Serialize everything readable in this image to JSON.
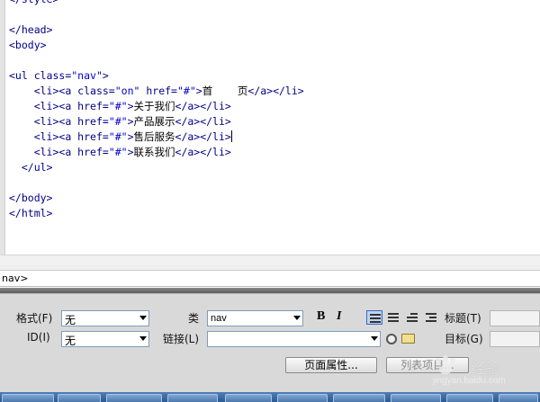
{
  "editor": {
    "lines": [
      [
        {
          "c": "t",
          "s": "</style>"
        }
      ],
      [],
      [
        {
          "c": "t",
          "s": "</head>"
        }
      ],
      [
        {
          "c": "t",
          "s": "<body>"
        }
      ],
      [],
      [
        {
          "c": "t",
          "s": "<ul "
        },
        {
          "c": "a",
          "s": "class="
        },
        {
          "c": "v",
          "s": "\"nav\""
        },
        {
          "c": "t",
          "s": ">"
        }
      ],
      [
        {
          "c": "x",
          "s": "    "
        },
        {
          "c": "t",
          "s": "<li><a "
        },
        {
          "c": "a",
          "s": "class="
        },
        {
          "c": "v",
          "s": "\"on\""
        },
        {
          "c": "a",
          "s": " href="
        },
        {
          "c": "v",
          "s": "\"#\""
        },
        {
          "c": "t",
          "s": ">"
        },
        {
          "c": "x",
          "s": "首    页"
        },
        {
          "c": "t",
          "s": "</a></li>"
        }
      ],
      [
        {
          "c": "x",
          "s": "    "
        },
        {
          "c": "t",
          "s": "<li><a "
        },
        {
          "c": "a",
          "s": "href="
        },
        {
          "c": "v",
          "s": "\"#\""
        },
        {
          "c": "t",
          "s": ">"
        },
        {
          "c": "x",
          "s": "关于我们"
        },
        {
          "c": "t",
          "s": "</a></li>"
        }
      ],
      [
        {
          "c": "x",
          "s": "    "
        },
        {
          "c": "t",
          "s": "<li><a "
        },
        {
          "c": "a",
          "s": "href="
        },
        {
          "c": "v",
          "s": "\"#\""
        },
        {
          "c": "t",
          "s": ">"
        },
        {
          "c": "x",
          "s": "产品展示"
        },
        {
          "c": "t",
          "s": "</a></li>"
        }
      ],
      [
        {
          "c": "x",
          "s": "    "
        },
        {
          "c": "t",
          "s": "<li><a "
        },
        {
          "c": "a",
          "s": "href="
        },
        {
          "c": "v",
          "s": "\"#\""
        },
        {
          "c": "t",
          "s": ">"
        },
        {
          "c": "x",
          "s": "售后服务"
        },
        {
          "c": "t",
          "s": "</a></li>"
        },
        {
          "c": "caret",
          "s": ""
        }
      ],
      [
        {
          "c": "x",
          "s": "    "
        },
        {
          "c": "t",
          "s": "<li><a "
        },
        {
          "c": "a",
          "s": "href="
        },
        {
          "c": "v",
          "s": "\"#\""
        },
        {
          "c": "t",
          "s": ">"
        },
        {
          "c": "x",
          "s": "联系我们"
        },
        {
          "c": "t",
          "s": "</a></li>"
        }
      ],
      [
        {
          "c": "x",
          "s": "  "
        },
        {
          "c": "t",
          "s": "</ul>"
        }
      ],
      [],
      [
        {
          "c": "t",
          "s": "</body>"
        }
      ],
      [
        {
          "c": "t",
          "s": "</html>"
        }
      ]
    ]
  },
  "tag_selector": {
    "path": "nav>"
  },
  "properties": {
    "format_label": "格式(F)",
    "format_value": "无",
    "id_label": "ID(I)",
    "id_value": "无",
    "class_label": "类",
    "class_value": "nav",
    "bold_label": "B",
    "italic_label": "I",
    "link_label": "链接(L)",
    "link_value": "",
    "title_label": "标题(T)",
    "target_label": "目标(G)",
    "page_props_button": "页面属性...",
    "list_item_button": "列表项目..."
  },
  "watermark": {
    "text": "经验",
    "url": "jingyan.baidu.com"
  },
  "colors": {
    "tag": "#000088",
    "value": "#0000cc",
    "panel": "#d9d9d9",
    "taskbar": "#2a5a94"
  }
}
